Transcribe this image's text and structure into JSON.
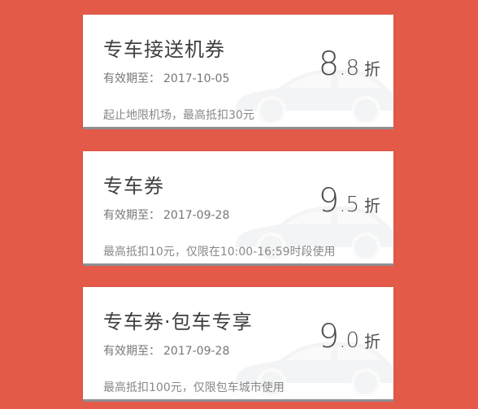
{
  "coupons": [
    {
      "title": "专车接送机券",
      "validity_label": "有效期至：",
      "validity_date": "2017-10-05",
      "discount_int": "8",
      "discount_dec": ".8",
      "discount_unit": "折",
      "note": "起止地限机场，最高抵扣30元"
    },
    {
      "title": "专车券",
      "validity_label": "有效期至：",
      "validity_date": "2017-09-28",
      "discount_int": "9",
      "discount_dec": ".5",
      "discount_unit": "折",
      "note": "最高抵扣10元，仅限在10:00-16:59时段使用"
    },
    {
      "title": "专车券·包车专享",
      "validity_label": "有效期至：",
      "validity_date": "2017-09-28",
      "discount_int": "9",
      "discount_dec": ".0",
      "discount_unit": "折",
      "note": "最高抵扣100元，仅限包车城市使用"
    }
  ],
  "colors": {
    "background": "#e35b48",
    "card": "#ffffff",
    "title_text": "#3f3f3f",
    "discount_text": "#4a4a4a"
  },
  "icons": [
    "car-watermark-icon"
  ]
}
